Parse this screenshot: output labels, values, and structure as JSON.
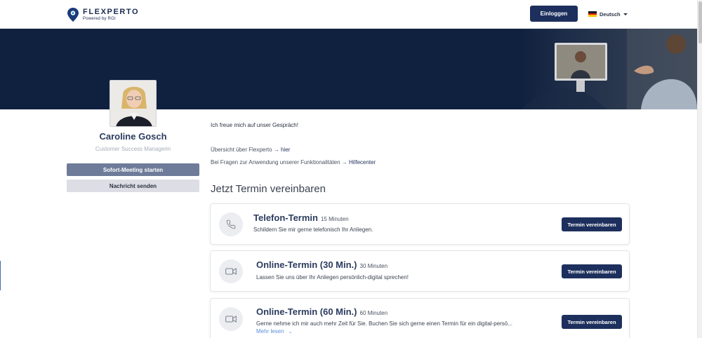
{
  "header": {
    "logo_name": "FLEXPERTO",
    "logo_sub": "Powered by RGI",
    "login_label": "Einloggen",
    "language": "Deutsch"
  },
  "profile": {
    "name": "Caroline Gosch",
    "role": "Customer Success Managerin",
    "meeting_button": "Sofort-Meeting starten",
    "message_button": "Nachricht senden"
  },
  "main": {
    "intro": "Ich freue mich auf unser Gespräch!",
    "overview_prefix": "Übersicht über Flexperto → ",
    "overview_link": "hier",
    "help_prefix": "Bei Fragen zur Anwendung unserer Funktionalitäten → ",
    "help_link": "Hilfecenter",
    "section_title": "Jetzt Termin vereinbaren"
  },
  "cards": [
    {
      "icon": "phone-icon",
      "title": "Telefon-Termin",
      "duration": "15 Minuten",
      "description": "Schildern Sie mir gerne telefonisch Ihr Anliegen.",
      "button": "Termin vereinbaren"
    },
    {
      "icon": "video-camera-icon",
      "title": "Online-Termin (30 Min.)",
      "duration": "30 Minuten",
      "description": "Lassen Sie uns über Ihr Anliegen persönlich-digital sprechen!",
      "button": "Termin vereinbaren"
    },
    {
      "icon": "video-camera-icon",
      "title": "Online-Termin (60 Min.)",
      "duration": "60 Minuten",
      "description": "Gerne nehme ich mir auch mehr Zeit für Sie. Buchen Sie sich gerne einen Termin für ein digital-persö...",
      "more": "Mehr lesen",
      "button": "Termin vereinbaren"
    }
  ],
  "colors": {
    "navy": "#1d2f5c",
    "banner": "#10213f",
    "link_blue": "#5a8fd8"
  }
}
